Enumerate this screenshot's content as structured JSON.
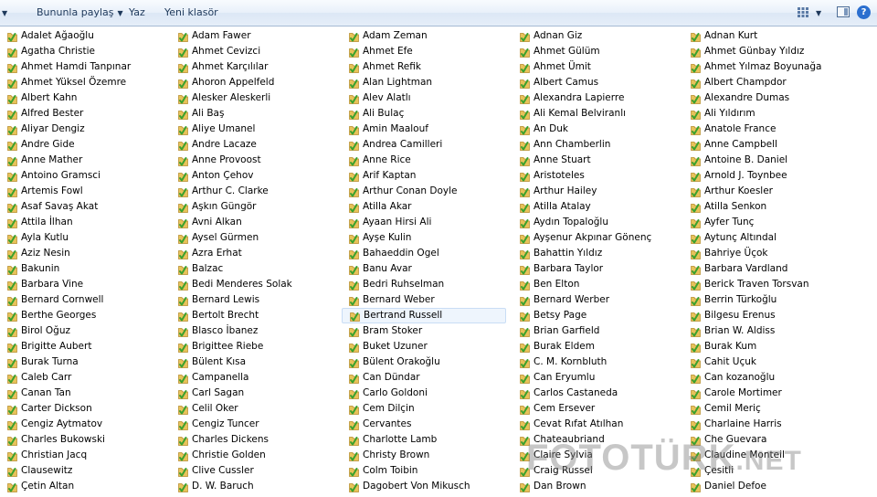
{
  "toolbar": {
    "share_label": "Bununla paylaş",
    "print_label": "Yaz",
    "new_folder_label": "Yeni klasör",
    "help_symbol": "?"
  },
  "columns": [
    [
      "Adalet Ağaoğlu",
      "Agatha Christie",
      "Ahmet Hamdi Tanpınar",
      "Ahmet Yüksel Özemre",
      "Albert Kahn",
      "Alfred Bester",
      "Aliyar Dengiz",
      "Andre Gide",
      "Anne Mather",
      "Antoino Gramsci",
      "Artemis Fowl",
      "Asaf Savaş Akat",
      "Attila İlhan",
      "Ayla Kutlu",
      "Aziz Nesin",
      "Bakunin",
      "Barbara Vine",
      "Bernard Cornwell",
      "Berthe Georges",
      "Birol Oğuz",
      "Brigitte Aubert",
      "Burak Turna",
      "Caleb Carr",
      "Canan Tan",
      "Carter Dickson",
      "Cengiz Aytmatov",
      "Charles Bukowski",
      "Christian Jacq",
      "Clausewitz",
      "Çetin Altan"
    ],
    [
      "Adam Fawer",
      "Ahmet Cevizci",
      "Ahmet Karçılılar",
      "Ahoron Appelfeld",
      "Alesker Aleskerli",
      "Ali Baş",
      "Aliye Umanel",
      "Andre Lacaze",
      "Anne Provoost",
      "Anton Çehov",
      "Arthur C. Clarke",
      "Aşkın Güngör",
      "Avni Alkan",
      "Aysel Gürmen",
      "Azra Erhat",
      "Balzac",
      "Bedi Menderes Solak",
      "Bernard Lewis",
      "Bertolt Brecht",
      "Blasco İbanez",
      "Brigittee Riebe",
      "Bülent Kısa",
      "Campanella",
      "Carl Sagan",
      "Celil Oker",
      "Cengiz Tuncer",
      "Charles Dickens",
      "Christie Golden",
      "Clive Cussler",
      "D. W. Baruch"
    ],
    [
      "Adam Zeman",
      "Ahmet Efe",
      "Ahmet Refik",
      "Alan Lightman",
      "Alev Alatlı",
      "Ali Bulaç",
      "Amin Maalouf",
      "Andrea Camilleri",
      "Anne Rice",
      "Arif Kaptan",
      "Arthur Conan Doyle",
      "Atilla Akar",
      "Ayaan Hirsi Ali",
      "Ayşe Kulin",
      "Bahaeddin Ogel",
      "Banu Avar",
      "Bedri Ruhselman",
      "Bernard Weber",
      "Bertrand Russell",
      "Bram Stoker",
      "Buket Uzuner",
      "Bülent Orakoğlu",
      "Can Dündar",
      "Carlo Goldoni",
      "Cem Dilçin",
      "Cervantes",
      "Charlotte Lamb",
      "Christy Brown",
      "Colm Toibin",
      "Dagobert Von Mikusch"
    ],
    [
      "Adnan Giz",
      "Ahmet Gülüm",
      "Ahmet Ümit",
      "Albert Camus",
      "Alexandra Lapierre",
      "Ali Kemal Belviranlı",
      "An Duk",
      "Ann Chamberlin",
      "Anne Stuart",
      "Aristoteles",
      "Arthur Hailey",
      "Atilla Atalay",
      "Aydın Topaloğlu",
      "Ayşenur Akpınar Gönenç",
      "Bahattin Yıldız",
      "Barbara Taylor",
      "Ben Elton",
      "Bernard Werber",
      "Betsy Page",
      "Brian Garfield",
      "Burak Eldem",
      "C. M. Kornbluth",
      "Can Eryumlu",
      "Carlos Castaneda",
      "Cem Ersever",
      "Cevat Rıfat Atılhan",
      "Chateaubriand",
      "Claire Sylvia",
      "Craig Russel",
      "Dan Brown"
    ],
    [
      "Adnan Kurt",
      "Ahmet Günbay Yıldız",
      "Ahmet Yılmaz Boyunağa",
      "Albert Champdor",
      "Alexandre Dumas",
      "Ali Yıldırım",
      "Anatole France",
      "Anne Campbell",
      "Antoine B. Daniel",
      "Arnold J. Toynbee",
      "Arthur Koesler",
      "Atilla Senkon",
      "Ayfer Tunç",
      "Aytunç Altındal",
      "Bahriye Üçok",
      "Barbara Vardland",
      "Berick Traven Torsvan",
      "Berrin Türkoğlu",
      "Bilgesu Erenus",
      "Brian W. Aldiss",
      "Burak Kum",
      "Cahit Uçuk",
      "Can kozanoğlu",
      "Carole Mortimer",
      "Cemil Meriç",
      "Charlaine Harris",
      "Che Guevara",
      "Claudine Monteil",
      "Çesitli",
      "Daniel Defoe"
    ]
  ],
  "selected_item": "Bertrand Russell",
  "watermark": {
    "main": "FOTOTÜRK",
    "suffix": ".NET"
  },
  "colors": {
    "toolbar_text": "#1e395b",
    "folder_icon": "#e8c25a",
    "check_icon": "#3aa12e",
    "selection_bg": "#eef5fd",
    "selection_border": "#c9ddf5"
  }
}
